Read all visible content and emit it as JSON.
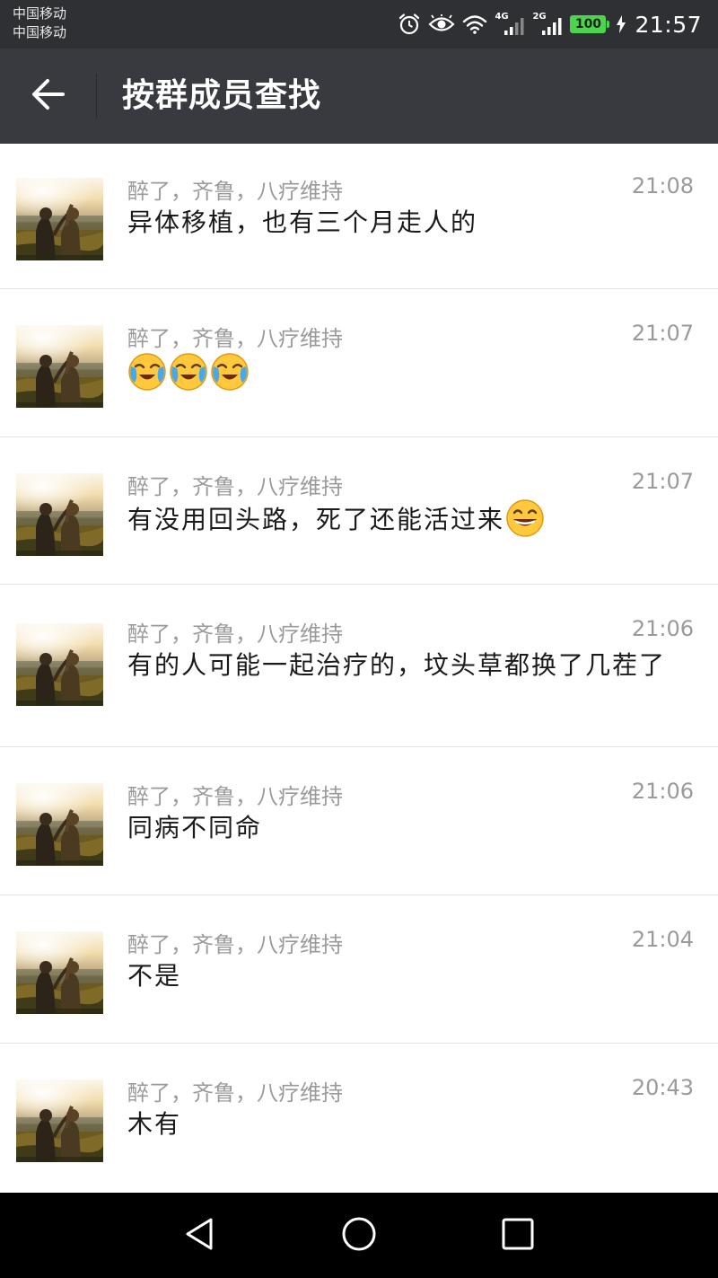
{
  "status_bar": {
    "carrier_1": "中国移动",
    "carrier_2": "中国移动",
    "network_1": "4G",
    "network_2": "2G",
    "battery": "100",
    "time": "21:57",
    "icons": [
      "alarm-icon",
      "eye-icon",
      "wifi-icon",
      "signal-icon",
      "signal-icon",
      "battery-icon",
      "charging-icon"
    ]
  },
  "header": {
    "back_icon": "arrow-left-icon",
    "title": "按群成员查找"
  },
  "messages": [
    {
      "sender": "醉了，齐鲁，八疗维持",
      "time": "21:08",
      "text": "异体移植，也有三个月走人的"
    },
    {
      "sender": "醉了，齐鲁，八疗维持",
      "time": "21:07",
      "text": "",
      "emojis": [
        "crying-emoji",
        "crying-emoji",
        "crying-emoji"
      ]
    },
    {
      "sender": "醉了，齐鲁，八疗维持",
      "time": "21:07",
      "text": "有没用回头路，死了还能活过来",
      "trailing_emoji": "grinning-emoji"
    },
    {
      "sender": "醉了，齐鲁，八疗维持",
      "time": "21:06",
      "text": "有的人可能一起治疗的，坟头草都换了几茬了"
    },
    {
      "sender": "醉了，齐鲁，八疗维持",
      "time": "21:06",
      "text": "同病不同命"
    },
    {
      "sender": "醉了，齐鲁，八疗维持",
      "time": "21:04",
      "text": "不是"
    },
    {
      "sender": "醉了，齐鲁，八疗维持",
      "time": "20:43",
      "text": "木有"
    }
  ],
  "nav_bar": {
    "buttons": [
      "back-triangle-icon",
      "home-circle-icon",
      "recents-square-icon"
    ]
  },
  "colors": {
    "status_bar_bg": "#2f3033",
    "header_bg": "#393a3f",
    "battery_green": "#4cd54c",
    "secondary_text": "#9a9a9a",
    "primary_text": "#1a1a1a",
    "divider": "#e3e3e3"
  }
}
